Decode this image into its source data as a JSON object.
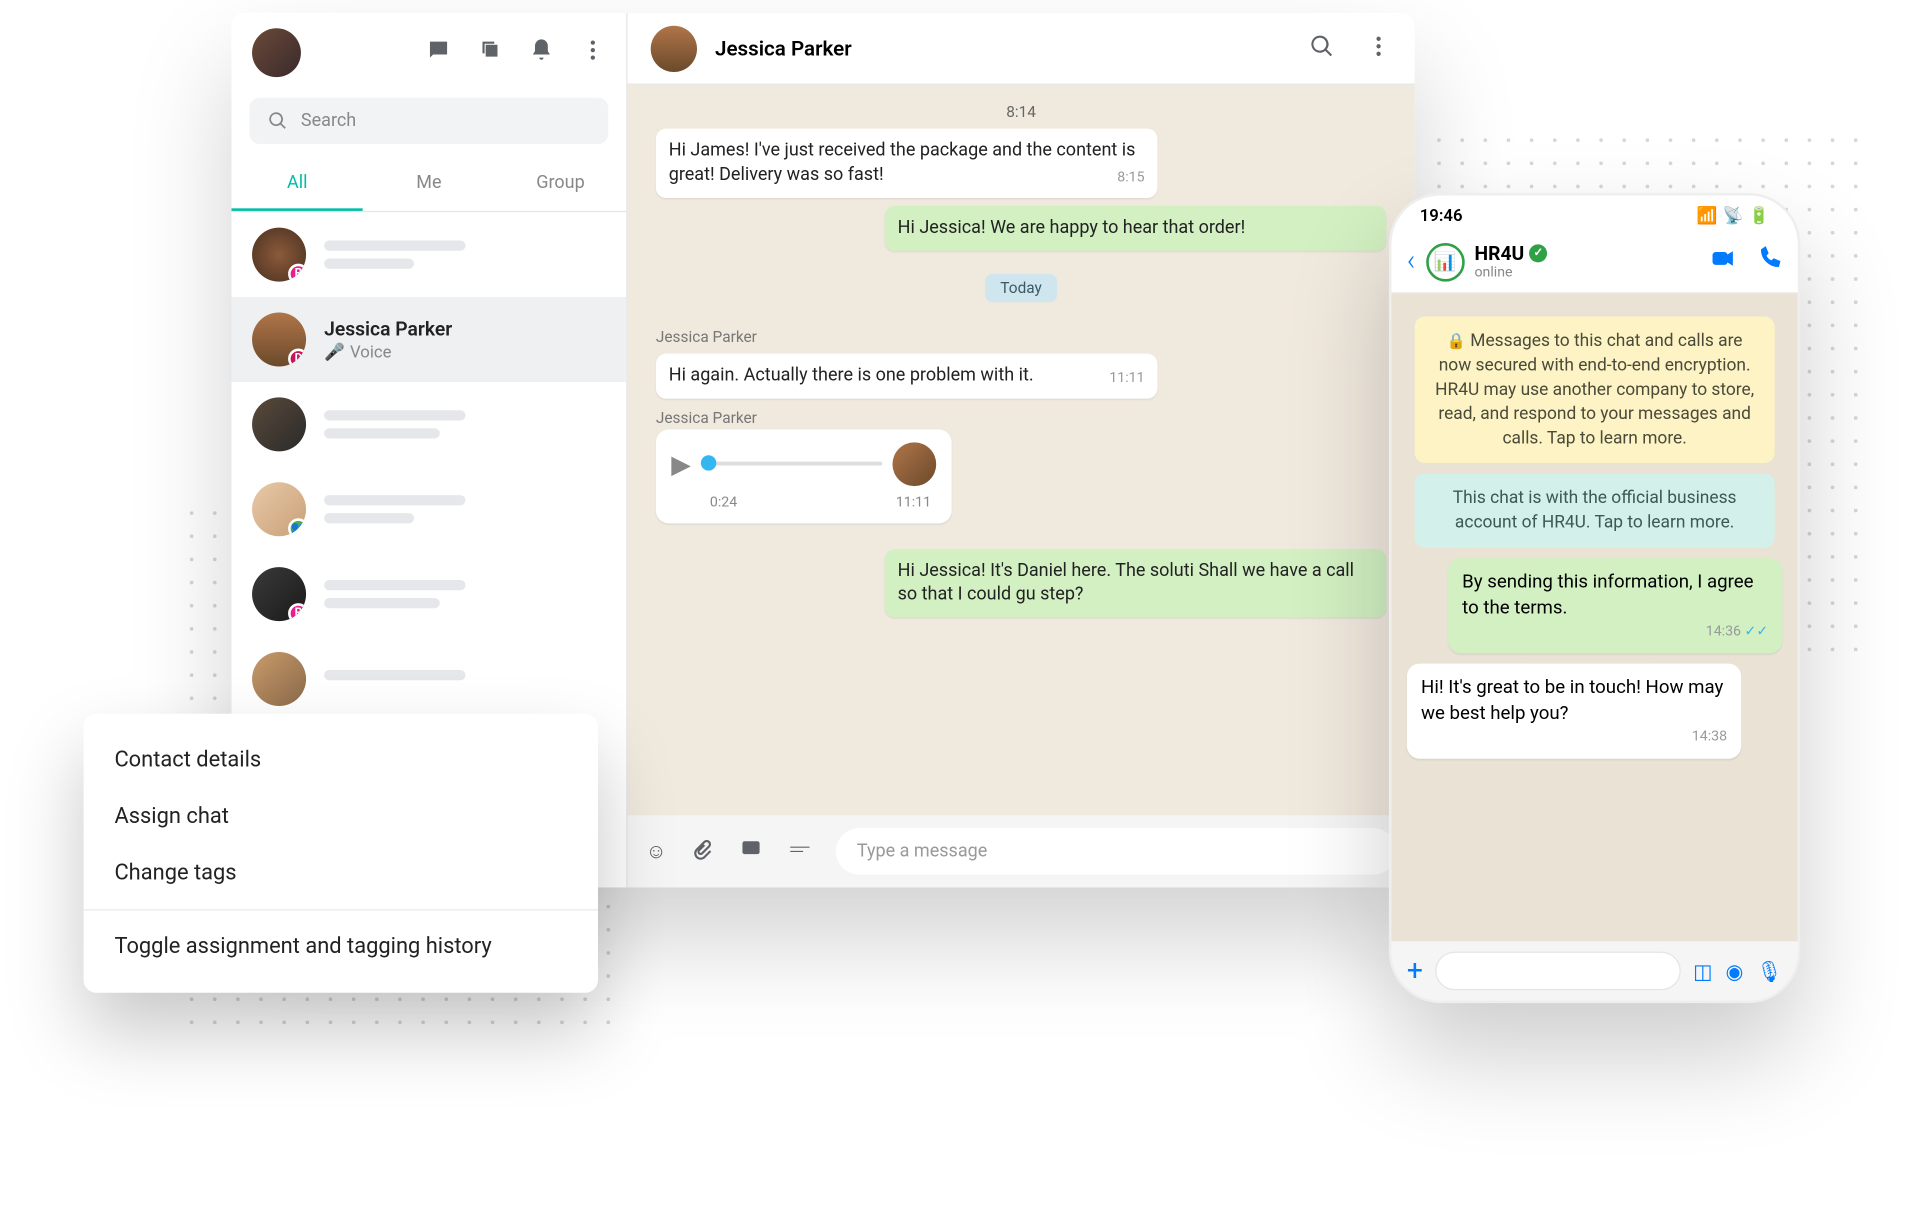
{
  "sidebar": {
    "search_placeholder": "Search",
    "tabs": [
      "All",
      "Me",
      "Group"
    ],
    "active": {
      "name": "Jessica Parker",
      "sub": "Voice"
    }
  },
  "chat": {
    "name": "Jessica Parker",
    "t0": "8:14",
    "m1": "Hi James! I've just received the package and the content is great! Delivery was so fast!",
    "m1t": "8:15",
    "m2": "Hi Jessica! We are happy to hear that order!",
    "day": "Today",
    "s1": "Jessica Parker",
    "m3": "Hi again. Actually there is one problem with it.",
    "m3t": "11:11",
    "s2": "Jessica Parker",
    "vdur": "0:24",
    "vt": "11:11",
    "m4": "Hi Jessica! It's Daniel here. The soluti Shall we have a call so that I could gu step?",
    "input_placeholder": "Type a message"
  },
  "menu": {
    "i1": "Contact details",
    "i2": "Assign chat",
    "i3": "Change tags",
    "i4": "Toggle assignment and tagging history"
  },
  "phone": {
    "time": "19:46",
    "biz": "HR4U",
    "status": "online",
    "sys1": "Messages to this chat and calls are now secured with end-to-end encryption. HR4U may use another company to store, read, and respond to your messages and calls. Tap to learn more.",
    "sys2": "This chat is with the official business account of HR4U. Tap to learn more.",
    "m1": "By sending this information, I agree to the terms.",
    "m1t": "14:36",
    "m2": "Hi! It's great to be in touch! How may we best help you?",
    "m2t": "14:38"
  }
}
